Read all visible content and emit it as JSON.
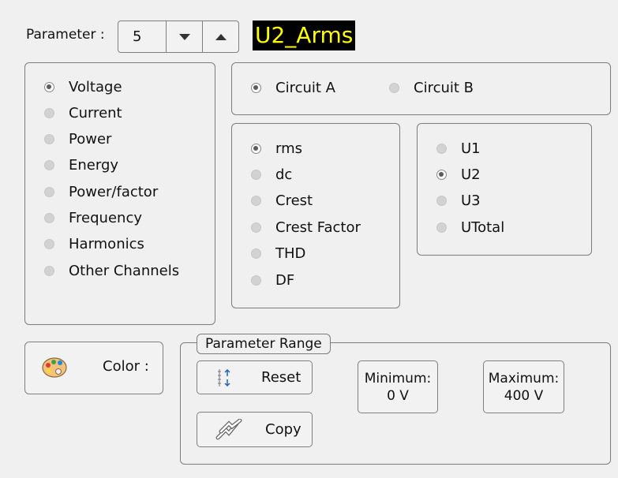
{
  "parameter": {
    "label": "Parameter :",
    "value": "5",
    "name": "U2_Arms",
    "down_icon": "triangle-down-icon",
    "up_icon": "triangle-up-icon",
    "name_bg": "#000000",
    "name_fg": "#ffff00"
  },
  "categories": {
    "items": [
      "Voltage",
      "Current",
      "Power",
      "Energy",
      "Power/factor",
      "Frequency",
      "Harmonics",
      "Other Channels"
    ],
    "selected": "Voltage"
  },
  "circuits": {
    "items": [
      "Circuit A",
      "Circuit B"
    ],
    "selected": "Circuit A"
  },
  "measures": {
    "items": [
      "rms",
      "dc",
      "Crest",
      "Crest Factor",
      "THD",
      "DF"
    ],
    "selected": "rms"
  },
  "channels": {
    "items": [
      "U1",
      "U2",
      "U3",
      "UTotal"
    ],
    "selected": "U2"
  },
  "color": {
    "label": "Color :",
    "icon": "palette-icon"
  },
  "range": {
    "title": "Parameter Range",
    "reset_label": "Reset",
    "reset_icon": "range-reset-icon",
    "copy_label": "Copy",
    "copy_icon": "copy-arrows-icon",
    "min_label": "Minimum:",
    "min_value": "0 V",
    "max_label": "Maximum:",
    "max_value": "400 V"
  }
}
